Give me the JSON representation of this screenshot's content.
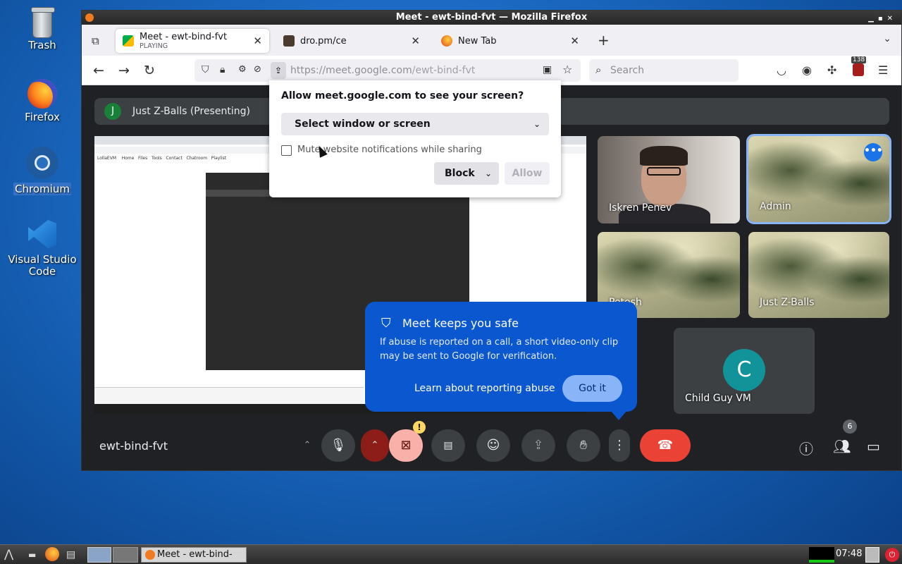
{
  "desktop": {
    "icons": [
      {
        "label": "Trash"
      },
      {
        "label": "Firefox"
      },
      {
        "label": "Chromium"
      },
      {
        "label": "Visual Studio Code"
      }
    ]
  },
  "window": {
    "title": "Meet - ewt-bind-fvt — Mozilla Firefox"
  },
  "tabs": [
    {
      "label": "Meet - ewt-bind-fvt",
      "status": "PLAYING"
    },
    {
      "label": "dro.pm/ce"
    },
    {
      "label": "New Tab"
    }
  ],
  "navbar": {
    "url_host": "https://meet.google.com",
    "url_path": "/ewt-bind-fvt",
    "search_placeholder": "Search",
    "extension_badge": "138"
  },
  "meet": {
    "presenter_initial": "J",
    "presenter_label": "Just Z-Balls (Presenting)",
    "meeting_name": "ewt-bind-fvt",
    "participants_count": "6",
    "tiles": [
      {
        "name": "Iskren Penev"
      },
      {
        "name": "Admin"
      },
      {
        "name": "Petesh"
      },
      {
        "name": "Just Z-Balls"
      },
      {
        "name": "Child Guy VM",
        "initial": "C"
      }
    ]
  },
  "permission_popup": {
    "question": "Allow meet.google.com to see your screen?",
    "select_label": "Select window or screen",
    "mute_label": "Mute website notifications while sharing",
    "block_label": "Block",
    "allow_label": "Allow"
  },
  "safety_tip": {
    "title": "Meet keeps you safe",
    "body": "If abuse is reported on a call, a short video-only clip may be sent to Google for verification.",
    "learn_link": "Learn about reporting abuse",
    "got_it": "Got it"
  },
  "taskbar": {
    "app_label": "Meet - ewt-bind-fvt...",
    "clock": "07:48"
  }
}
